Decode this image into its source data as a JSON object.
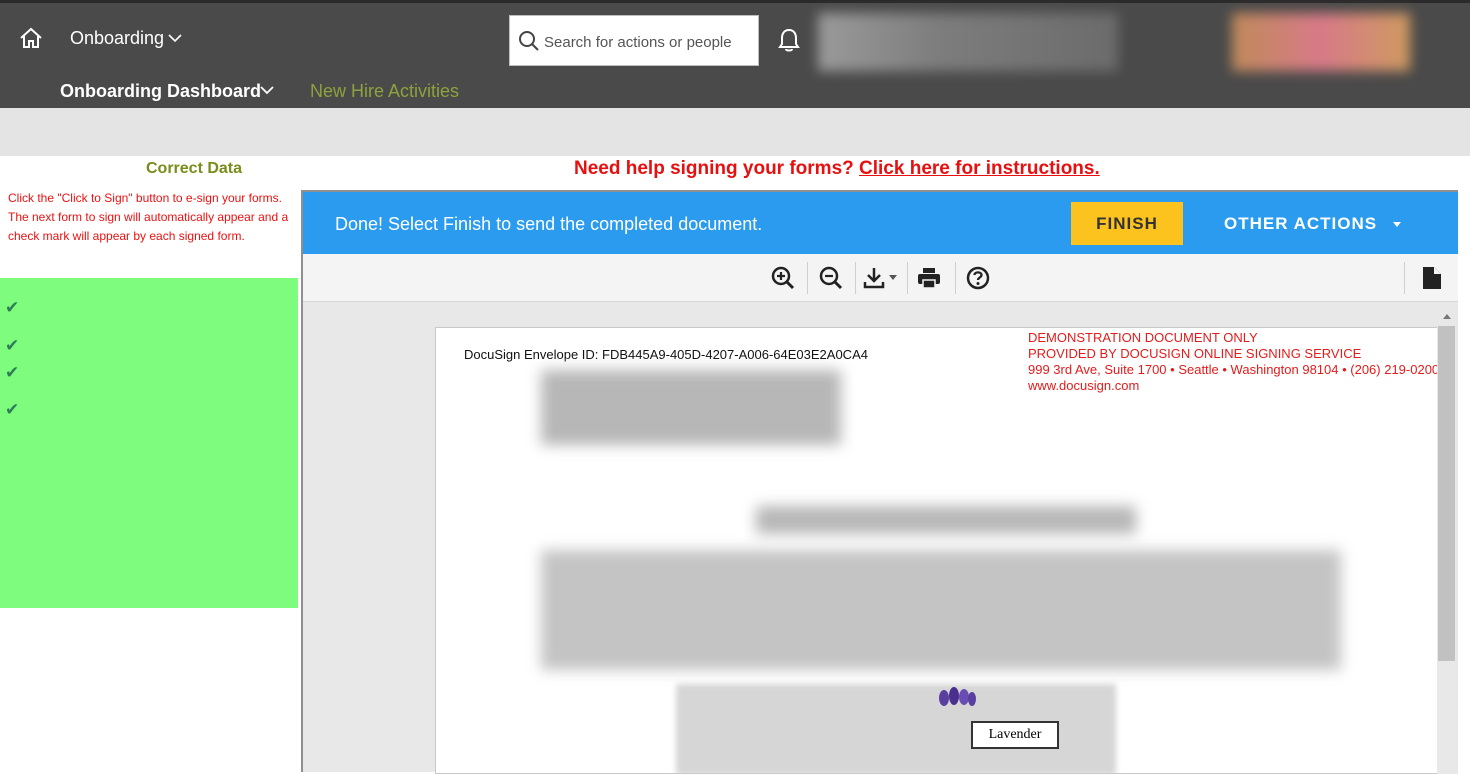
{
  "header": {
    "app_name": "Onboarding",
    "search_placeholder": "Search for actions or people",
    "nav_dashboard": "Onboarding Dashboard",
    "nav_new_hire": "New Hire Activities"
  },
  "left_panel": {
    "title": "Correct Data",
    "instructions_1": "Click the \"Click to Sign\" button to e-sign your forms.",
    "instructions_2": "The next form to sign will automatically appear and a check mark will appear by each signed form.",
    "check_glyph": "✔"
  },
  "help": {
    "question": "Need help signing your forms?",
    "link": "Click here for instructions."
  },
  "docusign": {
    "status_message": "Done! Select Finish to send the completed document.",
    "finish_label": "FINISH",
    "other_actions_label": "OTHER ACTIONS",
    "envelope_id": "DocuSign Envelope ID: FDB445A9-405D-4207-A006-64E03E2A0CA4",
    "demo_line_1": "DEMONSTRATION DOCUMENT ONLY",
    "demo_line_2": "PROVIDED BY DOCUSIGN ONLINE SIGNING SERVICE",
    "demo_line_3": "999 3rd Ave, Suite 1700  • Seattle • Washington 98104 • (206) 219-0200",
    "demo_line_4": "www.docusign.com",
    "map_label": "Lavender"
  },
  "colors": {
    "topbar": "#4a4a4a",
    "blue_bar": "#2b9bf0",
    "finish": "#fcc21e",
    "green_panel": "#7dfc7d",
    "help_red": "#e61010"
  }
}
